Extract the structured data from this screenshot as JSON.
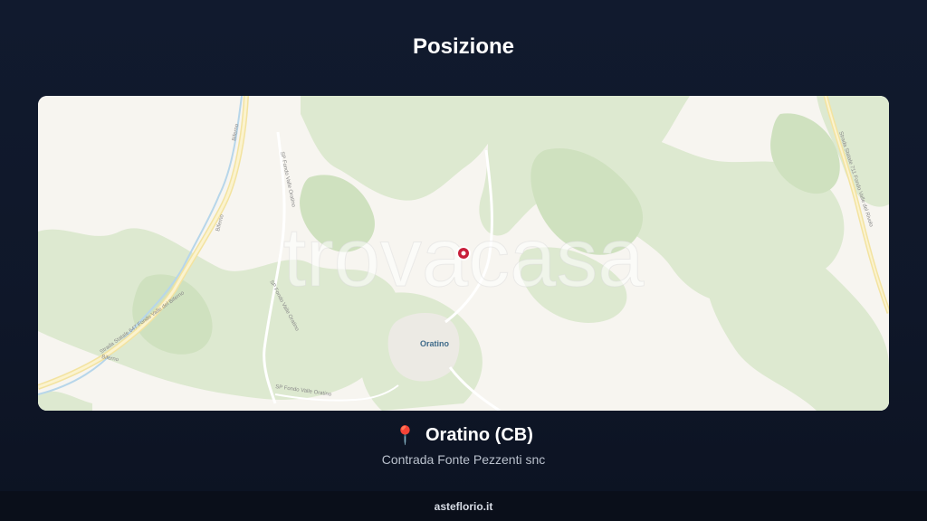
{
  "header": {
    "title": "Posizione"
  },
  "map": {
    "watermark": "trovacasa",
    "town_label": "Oratino",
    "road_labels": [
      "Strada Statale 647 Fondo Valle del Biferno",
      "SP Fondo Valle Oratino",
      "SP Fondo Valle Oratino",
      "SP Fondo Valle Oratino",
      "Strada Statale 711 Fondo Valle del Rivolo",
      "Biferno",
      "Biferno",
      "Biferno"
    ],
    "marker_color": "#c81e3a",
    "colors": {
      "land": "#f7f5f0",
      "forest": "#dbe9cf",
      "river": "#a9cde6",
      "road": "#f1df8a"
    }
  },
  "location": {
    "pin_icon": "📍",
    "name": "Oratino (CB)",
    "address": "Contrada Fonte Pezzenti snc"
  },
  "footer": {
    "text": "asteflorio.it"
  }
}
